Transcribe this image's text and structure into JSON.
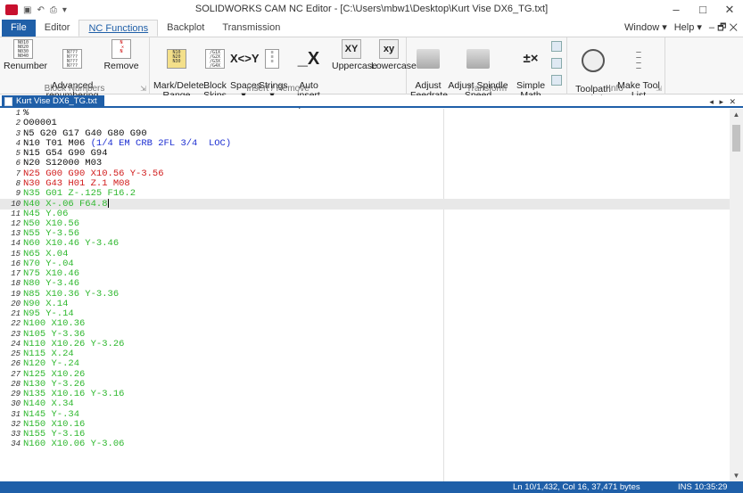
{
  "window": {
    "title": "SOLIDWORKS CAM NC Editor - [C:\\Users\\mbw1\\Desktop\\Kurt Vise DX6_TG.txt]",
    "controls": [
      "–",
      "□",
      "✕"
    ]
  },
  "ribbon_tabs": [
    {
      "label": "File",
      "active": false
    },
    {
      "label": "Editor",
      "active": false
    },
    {
      "label": "NC Functions",
      "active": true
    },
    {
      "label": "Backplot",
      "active": false
    },
    {
      "label": "Transmission",
      "active": false
    }
  ],
  "menu_right": {
    "window": "Window ▾",
    "help": "Help ▾",
    "controls": "– 🗗 ✕"
  },
  "ribbon": {
    "block_numbers": {
      "name": "Block Numbers",
      "buttons": [
        "Renumber",
        "Advanced\nrenumbering",
        "Remove"
      ]
    },
    "insert_remove": {
      "name": "Insert / Remove",
      "buttons": [
        "Mark/Delete\nRange",
        "Block\nSkips ▾",
        "Spaces\n▾",
        "Strings\n▾",
        "Auto insert\nspaces",
        "Uppercase",
        "Lowercase"
      ]
    },
    "transform": {
      "name": "Transform",
      "buttons": [
        "Adjust\nFeedrate",
        "Adjust Spindle\nSpeed",
        "Simple Math\nFunctions"
      ]
    },
    "info": {
      "name": "Info",
      "buttons": [
        "Toolpath\nStatistics",
        "Make Tool\nList"
      ]
    },
    "icon_text": {
      "swap": "X<>Y",
      "upper": "XY",
      "lower": "xy"
    }
  },
  "document_tab": {
    "label": "Kurt Vise DX6_TG.txt",
    "controls": "◂ ▸ ✕"
  },
  "editor": {
    "current_line": 10,
    "lines": [
      {
        "n": "1",
        "text": "%",
        "color": "black"
      },
      {
        "n": "2",
        "text": "O00001",
        "color": "black"
      },
      {
        "n": "3",
        "text": "N5 G20 G17 G40 G80 G90",
        "color": "black"
      },
      {
        "n": "4",
        "text": "N10 T01 M06 ",
        "color": "black",
        "comment": "(1/4 EM CRB 2FL 3/4  LOC)"
      },
      {
        "n": "5",
        "text": "N15 G54 G90 G94",
        "color": "black"
      },
      {
        "n": "6",
        "text": "N20 S12000 M03",
        "color": "black"
      },
      {
        "n": "7",
        "text": "N25 G00 G90 X10.56 Y-3.56",
        "color": "red"
      },
      {
        "n": "8",
        "text": "N30 G43 H01 Z.1 M08",
        "color": "red"
      },
      {
        "n": "9",
        "text": "N35 G01 Z-.125 F16.2",
        "color": "green"
      },
      {
        "n": "10",
        "text": "N40 X-.06 F64.8",
        "color": "green"
      },
      {
        "n": "11",
        "text": "N45 Y.06",
        "color": "green"
      },
      {
        "n": "12",
        "text": "N50 X10.56",
        "color": "green"
      },
      {
        "n": "13",
        "text": "N55 Y-3.56",
        "color": "green"
      },
      {
        "n": "14",
        "text": "N60 X10.46 Y-3.46",
        "color": "green"
      },
      {
        "n": "15",
        "text": "N65 X.04",
        "color": "green"
      },
      {
        "n": "16",
        "text": "N70 Y-.04",
        "color": "green"
      },
      {
        "n": "17",
        "text": "N75 X10.46",
        "color": "green"
      },
      {
        "n": "18",
        "text": "N80 Y-3.46",
        "color": "green"
      },
      {
        "n": "19",
        "text": "N85 X10.36 Y-3.36",
        "color": "green"
      },
      {
        "n": "20",
        "text": "N90 X.14",
        "color": "green"
      },
      {
        "n": "21",
        "text": "N95 Y-.14",
        "color": "green"
      },
      {
        "n": "22",
        "text": "N100 X10.36",
        "color": "green"
      },
      {
        "n": "23",
        "text": "N105 Y-3.36",
        "color": "green"
      },
      {
        "n": "24",
        "text": "N110 X10.26 Y-3.26",
        "color": "green"
      },
      {
        "n": "25",
        "text": "N115 X.24",
        "color": "green"
      },
      {
        "n": "26",
        "text": "N120 Y-.24",
        "color": "green"
      },
      {
        "n": "27",
        "text": "N125 X10.26",
        "color": "green"
      },
      {
        "n": "28",
        "text": "N130 Y-3.26",
        "color": "green"
      },
      {
        "n": "29",
        "text": "N135 X10.16 Y-3.16",
        "color": "green"
      },
      {
        "n": "30",
        "text": "N140 X.34",
        "color": "green"
      },
      {
        "n": "31",
        "text": "N145 Y-.34",
        "color": "green"
      },
      {
        "n": "32",
        "text": "N150 X10.16",
        "color": "green"
      },
      {
        "n": "33",
        "text": "N155 Y-3.16",
        "color": "green"
      },
      {
        "n": "34",
        "text": "N160 X10.06 Y-3.06",
        "color": "green"
      }
    ]
  },
  "status": {
    "position": "Ln 10/1,432, Col 16, 37,471 bytes",
    "mode_time": "INS  10:35:29"
  },
  "colors": {
    "accent": "#1f5fa8",
    "code_red": "#d11c1c",
    "code_green": "#2fb82f",
    "comment_blue": "#1c2ed1"
  }
}
